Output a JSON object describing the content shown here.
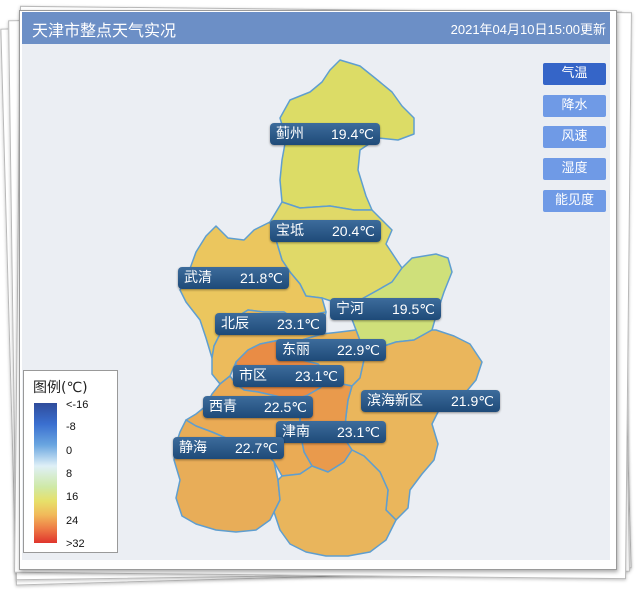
{
  "header": {
    "title": "天津市整点天气实况",
    "updated": "2021年04月10日15:00更新"
  },
  "buttons": [
    {
      "label": "气温",
      "active": true
    },
    {
      "label": "降水",
      "active": false
    },
    {
      "label": "风速",
      "active": false
    },
    {
      "label": "湿度",
      "active": false
    },
    {
      "label": "能见度",
      "active": false
    }
  ],
  "districts": [
    {
      "name": "蓟州",
      "temp": "19.4℃"
    },
    {
      "name": "宝坻",
      "temp": "20.4℃"
    },
    {
      "name": "武清",
      "temp": "21.8℃"
    },
    {
      "name": "宁河",
      "temp": "19.5℃"
    },
    {
      "name": "北辰",
      "temp": "23.1℃"
    },
    {
      "name": "东丽",
      "temp": "22.9℃"
    },
    {
      "name": "市区",
      "temp": "23.1℃"
    },
    {
      "name": "滨海新区",
      "temp": "21.9℃"
    },
    {
      "name": "西青",
      "temp": "22.5℃"
    },
    {
      "name": "津南",
      "temp": "23.1℃"
    },
    {
      "name": "静海",
      "temp": "22.7℃"
    }
  ],
  "legend": {
    "title": "图例(℃)",
    "ticks": [
      "<-16",
      "-8",
      "0",
      "8",
      "16",
      "24",
      ">32"
    ]
  },
  "colors": {
    "header_bg": "#6c8fc6",
    "button_active": "#3565c8",
    "button": "#6f9ae6",
    "label_bg": "#2a5585",
    "region_yellow": "#dcdc66",
    "region_light_green": "#cfe07a",
    "region_tan": "#ebc65e",
    "region_orange": "#e9a654",
    "region_deep_orange": "#e98c45",
    "border": "#5f9ecf"
  }
}
